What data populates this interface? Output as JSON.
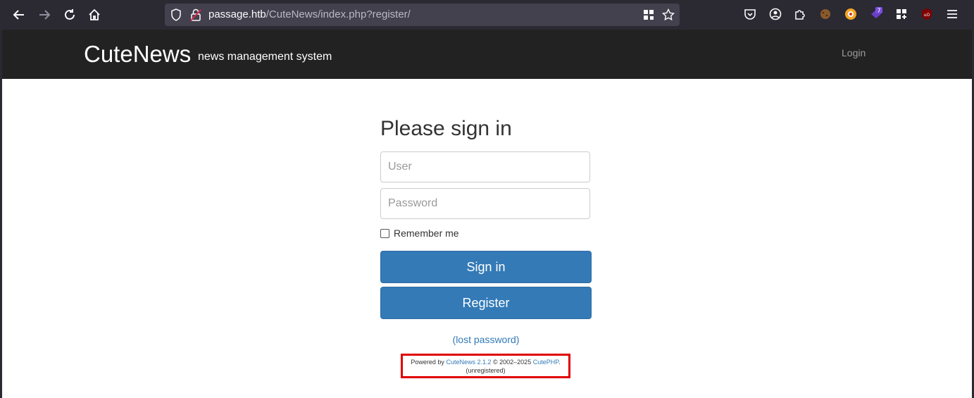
{
  "browser": {
    "url_host": "passage.htb",
    "url_path": "/CuteNews/index.php?register/",
    "badge_count": "7"
  },
  "navbar": {
    "brand": "CuteNews",
    "tagline": "news management system",
    "login_link": "Login"
  },
  "signin": {
    "heading": "Please sign in",
    "user_placeholder": "User",
    "password_placeholder": "Password",
    "remember_label": "Remember me",
    "signin_button": "Sign in",
    "register_button": "Register",
    "lost_password": "(lost password)"
  },
  "footer": {
    "powered_by": "Powered by",
    "product_link": "CuteNews 2.1.2",
    "copyright": "© 2002–2025",
    "company_link": "CutePHP",
    "period": ".",
    "status": "(unregistered)"
  },
  "colors": {
    "navbar": "#222222",
    "primary_button": "#337ab7",
    "highlight_box": "#e00000"
  }
}
